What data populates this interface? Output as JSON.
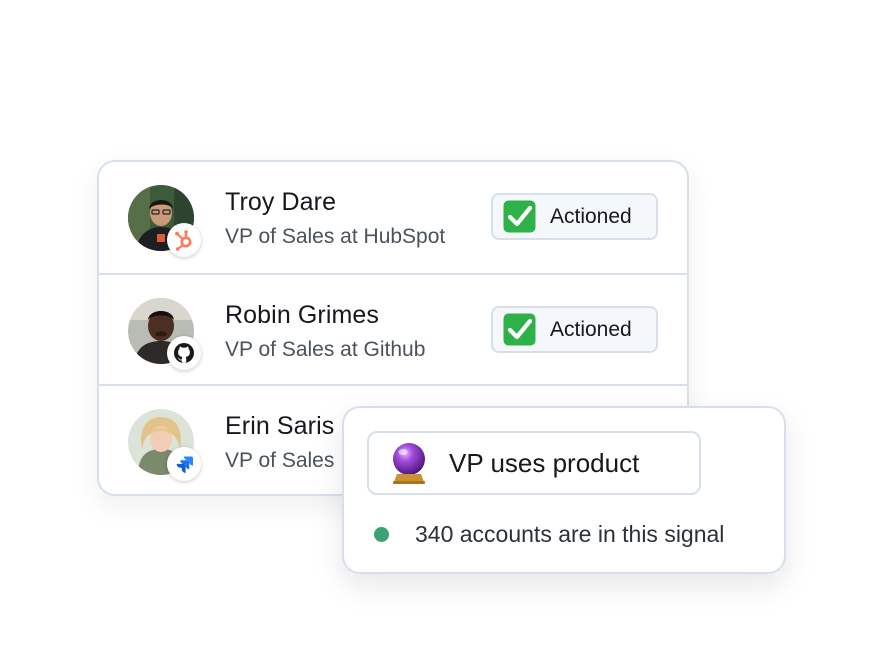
{
  "people": [
    {
      "name": "Troy Dare",
      "title": "VP of Sales at HubSpot",
      "company_icon": "hubspot-icon",
      "status": "Actioned",
      "status_icon": "check-mark-icon"
    },
    {
      "name": "Robin Grimes",
      "title": "VP of Sales at Github",
      "company_icon": "github-icon",
      "status": "Actioned",
      "status_icon": "check-mark-icon"
    },
    {
      "name": "Erin Saris",
      "title": "VP of Sales",
      "company_icon": "jira-icon"
    }
  ],
  "signal": {
    "icon": "crystal-ball-icon",
    "label": "VP uses product",
    "status_color": "#3aa374",
    "count_text": "340 accounts are in this signal"
  },
  "colors": {
    "border": "#d7e0ea",
    "check_green": "#2fb14a",
    "hubspot": "#ff7a59",
    "jira": "#2684ff",
    "status_dot": "#3aa374"
  }
}
